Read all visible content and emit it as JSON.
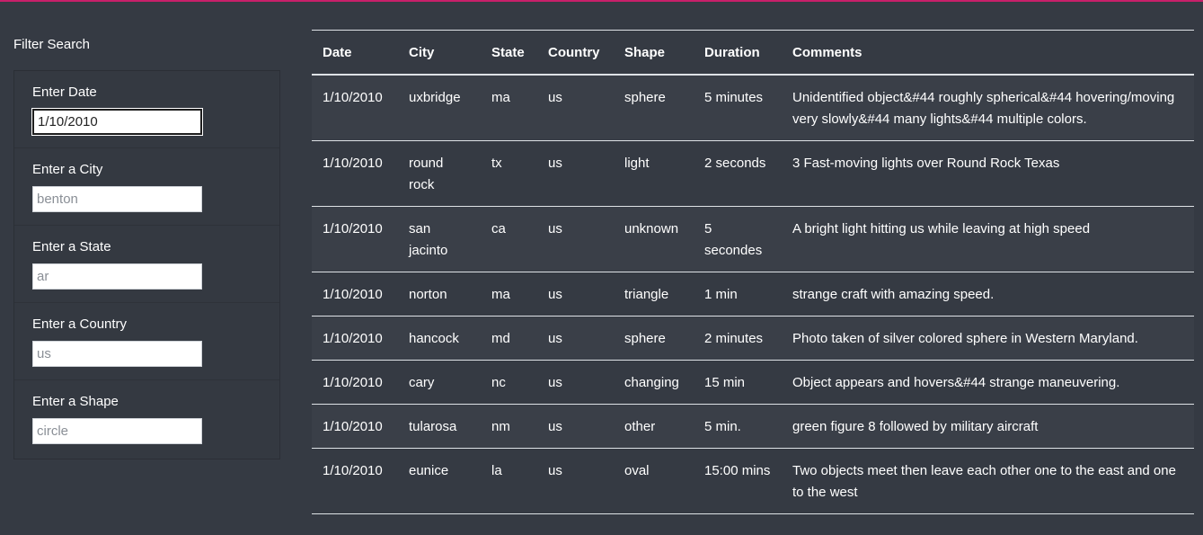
{
  "filter": {
    "title": "Filter Search",
    "fields": [
      {
        "label": "Enter Date",
        "value": "1/10/2010",
        "placeholder": ""
      },
      {
        "label": "Enter a City",
        "value": "",
        "placeholder": "benton"
      },
      {
        "label": "Enter a State",
        "value": "",
        "placeholder": "ar"
      },
      {
        "label": "Enter a Country",
        "value": "",
        "placeholder": "us"
      },
      {
        "label": "Enter a Shape",
        "value": "",
        "placeholder": "circle"
      }
    ]
  },
  "table": {
    "headers": [
      "Date",
      "City",
      "State",
      "Country",
      "Shape",
      "Duration",
      "Comments"
    ],
    "rows": [
      [
        "1/10/2010",
        "uxbridge",
        "ma",
        "us",
        "sphere",
        "5 minutes",
        "Unidentified object&#44 roughly spherical&#44 hovering/moving very slowly&#44 many lights&#44 multiple colors."
      ],
      [
        "1/10/2010",
        "round rock",
        "tx",
        "us",
        "light",
        "2 seconds",
        "3 Fast-moving lights over Round Rock Texas"
      ],
      [
        "1/10/2010",
        "san jacinto",
        "ca",
        "us",
        "unknown",
        "5 secondes",
        "A bright light hitting us while leaving at high speed"
      ],
      [
        "1/10/2010",
        "norton",
        "ma",
        "us",
        "triangle",
        "1 min",
        "strange craft with amazing speed."
      ],
      [
        "1/10/2010",
        "hancock",
        "md",
        "us",
        "sphere",
        "2 minutes",
        "Photo taken of silver colored sphere in Western Maryland."
      ],
      [
        "1/10/2010",
        "cary",
        "nc",
        "us",
        "changing",
        "15 min",
        "Object appears and hovers&#44 strange maneuvering."
      ],
      [
        "1/10/2010",
        "tularosa",
        "nm",
        "us",
        "other",
        "5 min.",
        "green figure 8 followed by military aircraft"
      ],
      [
        "1/10/2010",
        "eunice",
        "la",
        "us",
        "oval",
        "15:00 mins",
        "Two objects meet then leave each other one to the east and one to the west"
      ]
    ]
  },
  "colors": {
    "background": "#353a43",
    "accent_bar": "#c8206a"
  }
}
